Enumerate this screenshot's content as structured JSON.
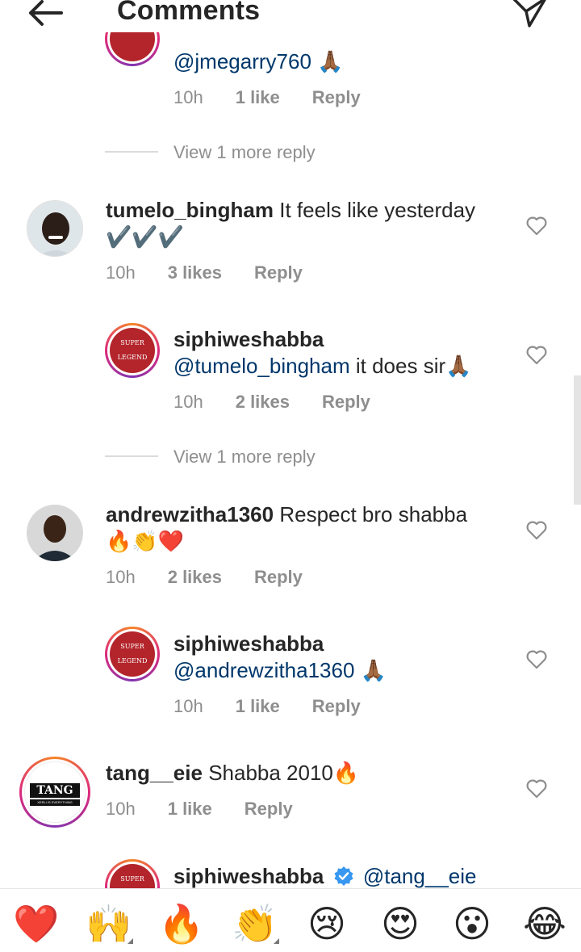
{
  "header": {
    "title": "Comments"
  },
  "comments": [
    {
      "id": "c0",
      "text": "@jmegarry760 🙏🏾",
      "time": "10h",
      "likes": "1 like",
      "reply": "Reply"
    },
    {
      "id": "c1",
      "view_more": "View 1 more reply"
    },
    {
      "id": "c2",
      "username": "tumelo_bingham",
      "text": "It feels like yesterday",
      "line2": "✔️✔️✔️",
      "time": "10h",
      "likes": "3 likes",
      "reply": "Reply"
    },
    {
      "id": "c3",
      "username": "siphiweshabba",
      "mention": "@tumelo_bingham",
      "text": "it does sir🙏🏾",
      "time": "10h",
      "likes": "2 likes",
      "reply": "Reply"
    },
    {
      "id": "c4",
      "view_more": "View 1 more reply"
    },
    {
      "id": "c5",
      "username": "andrewzitha1360",
      "text": "Respect bro shabba",
      "line2": "🔥👏❤️",
      "time": "10h",
      "likes": "2 likes",
      "reply": "Reply"
    },
    {
      "id": "c6",
      "username": "siphiweshabba",
      "mention": "@andrewzitha1360",
      "text": "🙏🏾",
      "time": "10h",
      "likes": "1 like",
      "reply": "Reply"
    },
    {
      "id": "c7",
      "username": "tang__eie",
      "text": "Shabba 2010🔥",
      "time": "10h",
      "likes": "1 like",
      "reply": "Reply"
    },
    {
      "id": "c8",
      "username": "siphiweshabba",
      "mention": "@tang__eie"
    }
  ],
  "avatars": {
    "legend_top": "SUPER",
    "legend_bottom": "LEGEND",
    "tang_logo": "TANG",
    "tang_tagline": "XERLI IS EVERYTHING"
  },
  "emoji_bar": [
    "❤️",
    "🙌",
    "🔥",
    "👏",
    "😢",
    "😍",
    "😮",
    "😂"
  ],
  "colors": {
    "text": "#262626",
    "meta": "#8e8e8e",
    "mention": "#00376b",
    "verified": "#3897f0"
  }
}
